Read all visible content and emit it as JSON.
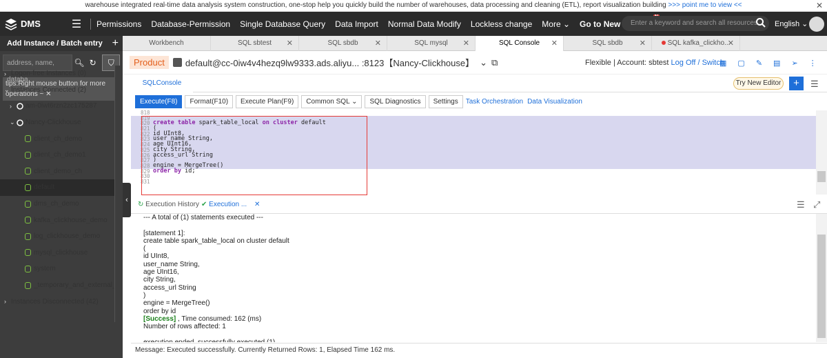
{
  "banner": {
    "text": "warehouse integrated real-time data analysis system construction, one-stop help you quickly build the number of warehouses, data processing and cleaning (ETL), report visualization building",
    "link": ">>> point me to view <<"
  },
  "nav": {
    "logo": "DMS",
    "items": [
      "Permissions",
      "Database-Permission",
      "Single Database Query",
      "Data Import",
      "Normal Data Modify",
      "Lockless change",
      "More"
    ],
    "new_version": "Go to New Version",
    "new_badge": "N",
    "search_placeholder": "Enter a keyword and search all resources",
    "lang": "English"
  },
  "sidebar": {
    "add_label": "Add Instance / Batch entry",
    "search_placeholder": "address, name, databa",
    "tips": "tips:Right mouse button for more operations ~",
    "tree": [
      {
        "label": "Logon-free Instances  (0)",
        "level": 0,
        "caret": "›"
      },
      {
        "label": "Instances Connected  (2)",
        "level": 0,
        "caret": "⌄"
      },
      {
        "label": "am-0iwt6rzn2zc175287",
        "level": 1,
        "caret": "›",
        "type": "instance"
      },
      {
        "label": "Nancy-Clickhouse",
        "level": 1,
        "caret": "⌄",
        "type": "instance"
      },
      {
        "label": "client_ch_demo",
        "level": 2,
        "type": "db"
      },
      {
        "label": "client_ch_demo1",
        "level": 2,
        "type": "db"
      },
      {
        "label": "client_demo_ch",
        "level": 2,
        "type": "db"
      },
      {
        "label": "default",
        "level": 2,
        "type": "db",
        "selected": true
      },
      {
        "label": "dms_ch_demo",
        "level": 2,
        "type": "db"
      },
      {
        "label": "kafka_clickhouse_demo",
        "level": 2,
        "type": "db"
      },
      {
        "label": "log_clickhouse_demo",
        "level": 2,
        "type": "db"
      },
      {
        "label": "mysql_clickhouse",
        "level": 2,
        "type": "db"
      },
      {
        "label": "system",
        "level": 2,
        "type": "db"
      },
      {
        "label": "_temporary_and_external_ta",
        "level": 2,
        "type": "db"
      },
      {
        "label": "Instances Disconnected  (42)",
        "level": 0,
        "caret": "›"
      }
    ]
  },
  "tabs": [
    {
      "label": "Workbench",
      "close": false
    },
    {
      "label": "SQL sbtest",
      "close": true
    },
    {
      "label": "SQL sbdb",
      "close": true
    },
    {
      "label": "SQL mysql",
      "close": true
    },
    {
      "label": "SQL Console",
      "close": true,
      "active": true
    },
    {
      "label": "SQL sbdb",
      "close": true
    },
    {
      "label": "SQL kafka_clickho...",
      "close": true,
      "red": true
    }
  ],
  "instance": {
    "product": "Product",
    "name": "default@cc-0iw4v4hezq9lw9333.ads.aliyu... :8123【Nancy-Clickhouse】",
    "account_text": "Flexible | Account: sbtest ",
    "logoff": "Log Off / Switch"
  },
  "console": {
    "tab": "SQLConsole",
    "try": "Try New Editor"
  },
  "toolbar": {
    "execute": "Execute(F8)",
    "format": "Format(F10)",
    "plan": "Execute Plan(F9)",
    "common": "Common SQL",
    "diagnostics": "SQL Diagnostics",
    "settings": "Settings",
    "orchestration": "Task Orchestration",
    "visualization": "Data Visualization"
  },
  "editor": {
    "lines": [
      {
        "n": "818",
        "code": "",
        "hl": false
      },
      {
        "n": "819",
        "code": "",
        "hl": true
      },
      {
        "n": "820",
        "code": "create table spark_table_local on cluster default",
        "hl": true,
        "kw": true
      },
      {
        "n": "821",
        "code": "(",
        "hl": true
      },
      {
        "n": "822",
        "code": "id UInt8,",
        "hl": true
      },
      {
        "n": "823",
        "code": "user_name String,",
        "hl": true
      },
      {
        "n": "824",
        "code": "age UInt16,",
        "hl": true
      },
      {
        "n": "825",
        "code": "city String,",
        "hl": true
      },
      {
        "n": "826",
        "code": "access_url String",
        "hl": true
      },
      {
        "n": "827",
        "code": ")",
        "hl": true
      },
      {
        "n": "828",
        "code": "engine = MergeTree()",
        "hl": true
      },
      {
        "n": "829",
        "code": "order by id;",
        "hl": false,
        "kw2": true
      },
      {
        "n": "830",
        "code": "",
        "hl": false
      },
      {
        "n": "831",
        "code": "",
        "hl": false
      }
    ]
  },
  "results": {
    "history_tab": "Execution History",
    "exec_tab": "Execution ...",
    "lines": [
      "--- A total of (1) statements executed ---",
      "",
      "[statement 1]:",
      "create table spark_table_local on cluster default",
      "(",
      "id UInt8,",
      "user_name String,",
      "age UInt16,",
      "city String,",
      "access_url String",
      ")",
      "engine = MergeTree()",
      "order by id"
    ],
    "success": "[Success]",
    "time": " , Time consumed: 162 (ms)",
    "rows": "Number of rows affected: 1",
    "ended": "execution ended, successfully executed (1)"
  },
  "status": "Message: Executed successfully. Currently Returned Rows: 1, Elapsed Time 162 ms."
}
